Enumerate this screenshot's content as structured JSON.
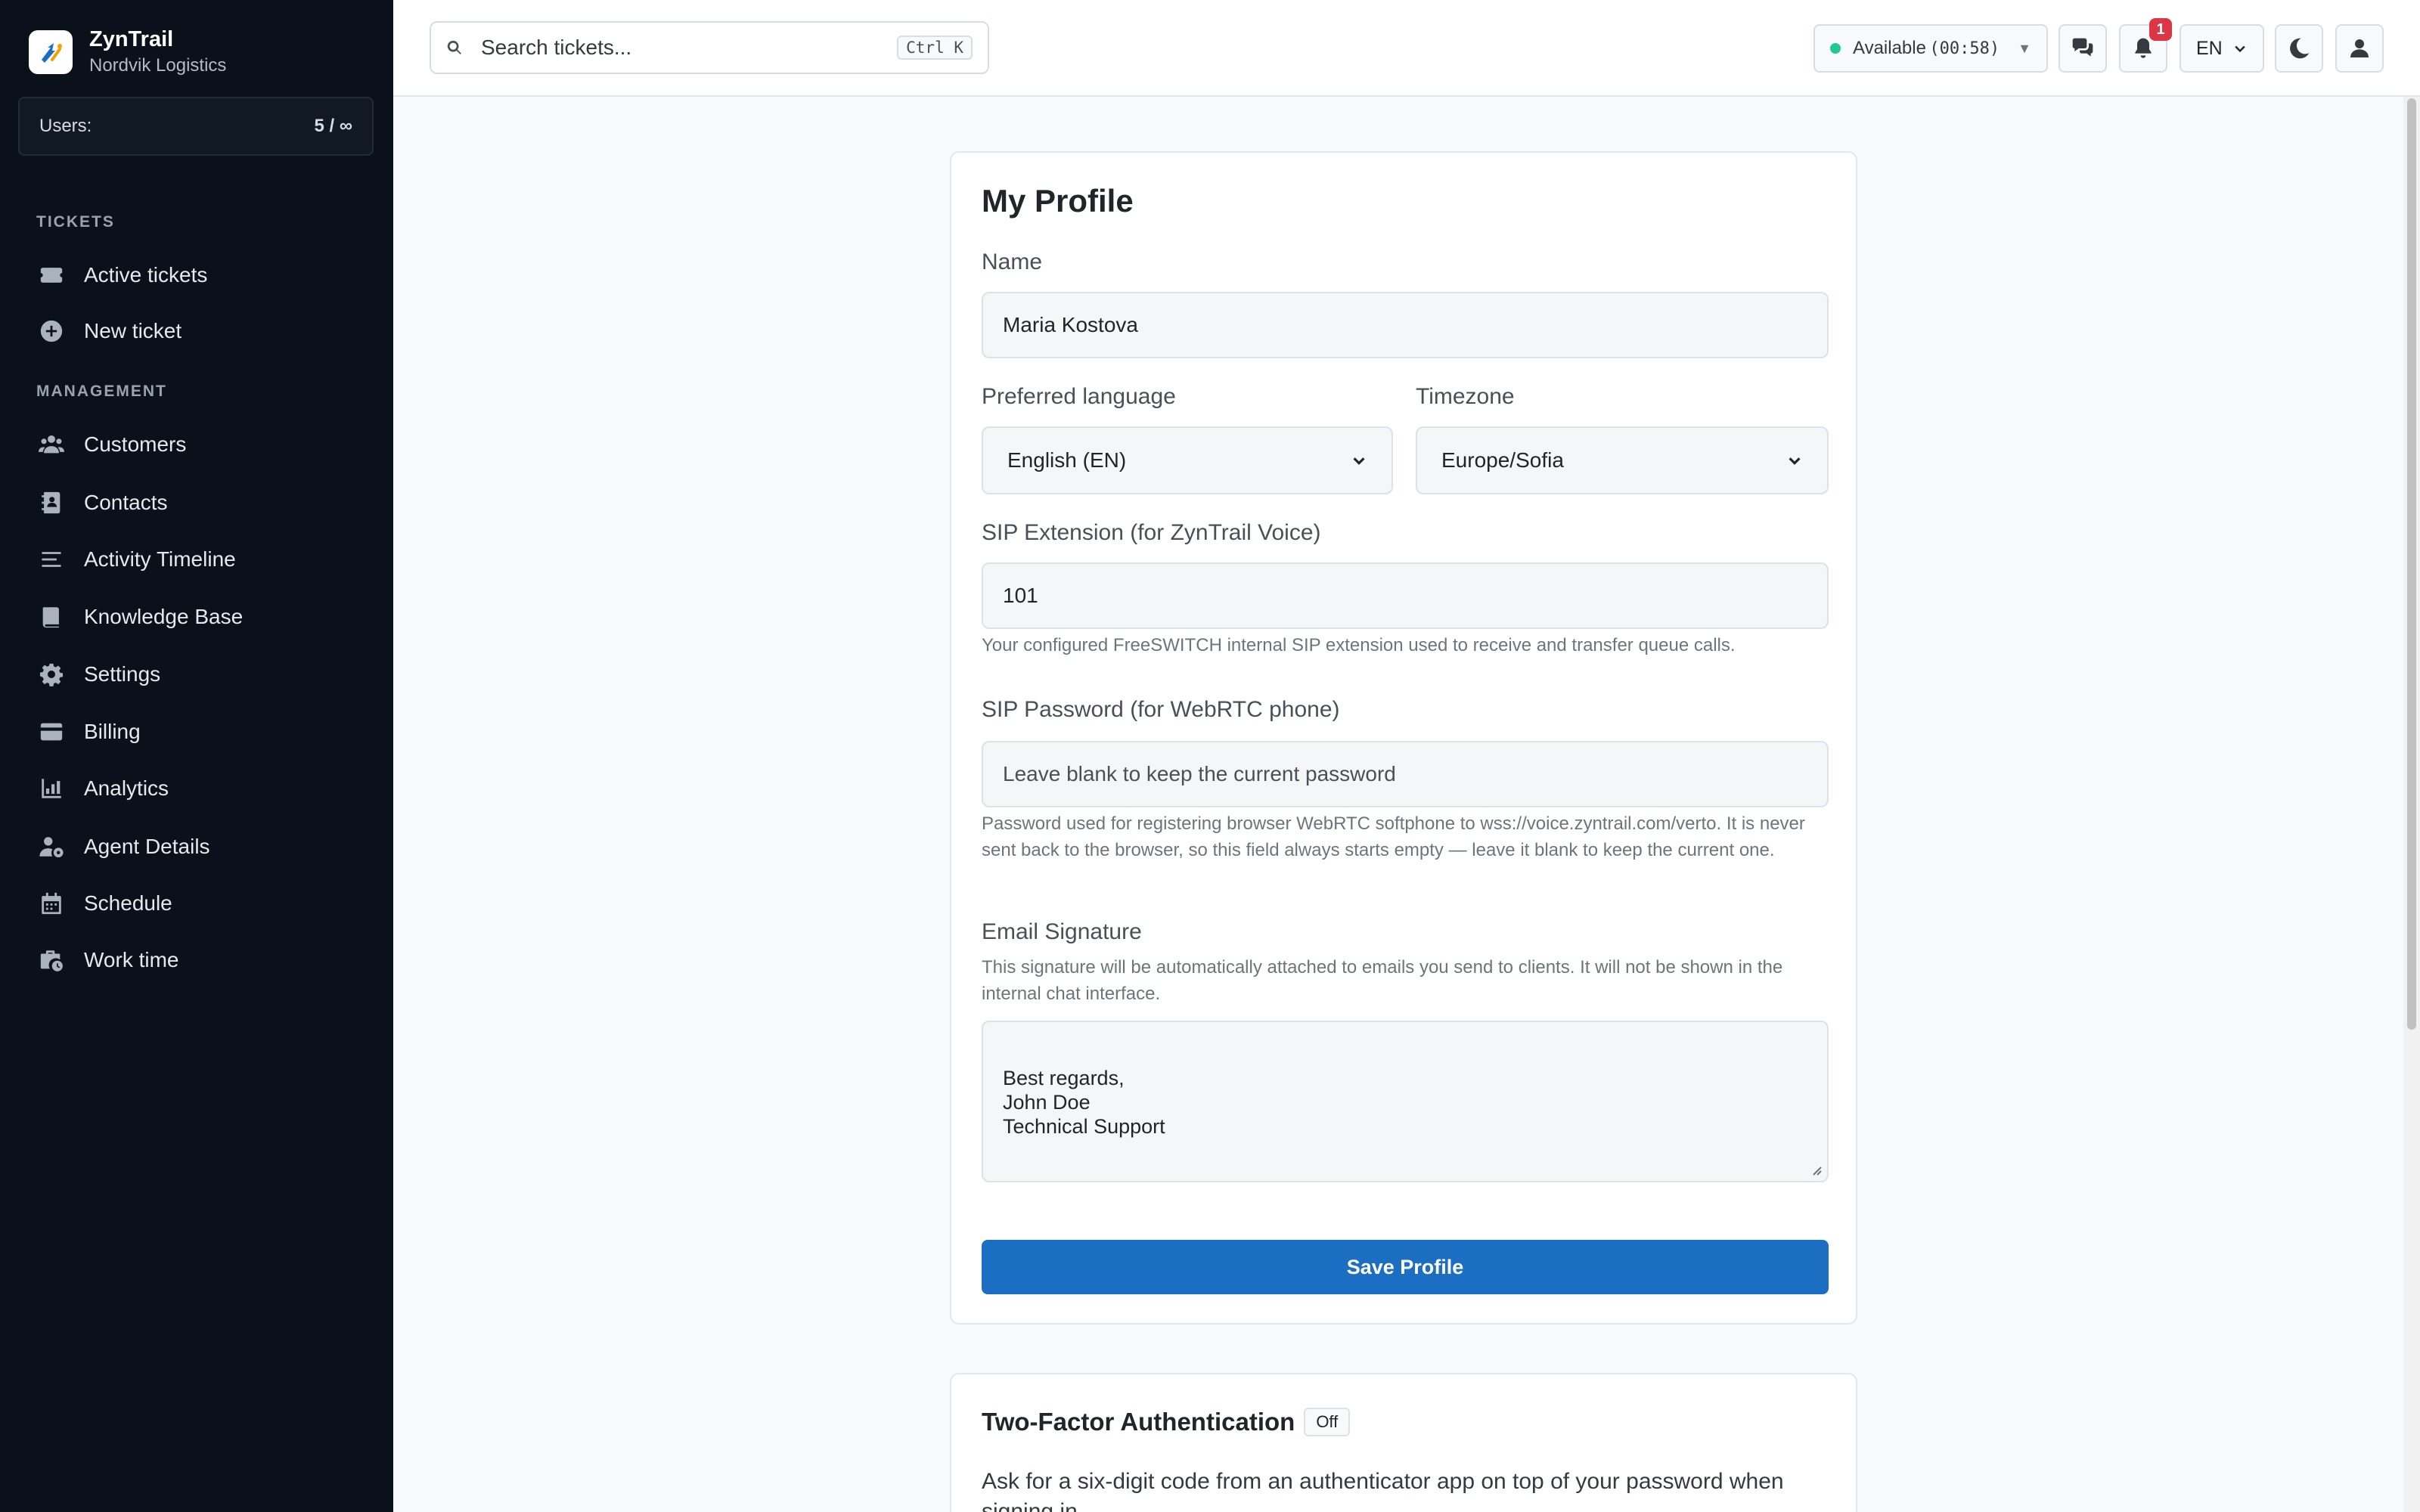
{
  "brand": {
    "name": "ZynTrail",
    "org": "Nordvik Logistics"
  },
  "users": {
    "label": "Users:",
    "value": "5 / ∞"
  },
  "nav": {
    "sections": {
      "tickets": "TICKETS",
      "management": "MANAGEMENT"
    },
    "items": [
      {
        "label": "Active tickets",
        "icon": "ticket-icon"
      },
      {
        "label": "New ticket",
        "icon": "plus-circle-icon"
      },
      {
        "label": "Customers",
        "icon": "users-icon"
      },
      {
        "label": "Contacts",
        "icon": "contact-book-icon"
      },
      {
        "label": "Activity Timeline",
        "icon": "list-icon"
      },
      {
        "label": "Knowledge Base",
        "icon": "book-icon"
      },
      {
        "label": "Settings",
        "icon": "gear-icon"
      },
      {
        "label": "Billing",
        "icon": "credit-card-icon"
      },
      {
        "label": "Analytics",
        "icon": "chart-icon"
      },
      {
        "label": "Agent Details",
        "icon": "user-gear-icon"
      },
      {
        "label": "Schedule",
        "icon": "calendar-icon"
      },
      {
        "label": "Work time",
        "icon": "briefcase-clock-icon"
      }
    ]
  },
  "topbar": {
    "search_placeholder": "Search tickets...",
    "search_shortcut": "Ctrl K",
    "status_label": "Available",
    "status_timer": "(00:58)",
    "status_color": "#20c997",
    "notifications_count": "1",
    "language": "EN"
  },
  "profile": {
    "title": "My Profile",
    "name_label": "Name",
    "name_value": "Maria Kostova",
    "language_label": "Preferred language",
    "language_value": "English (EN)",
    "timezone_label": "Timezone",
    "timezone_value": "Europe/Sofia",
    "sip_ext_label": "SIP Extension (for ZynTrail Voice)",
    "sip_ext_value": "101",
    "sip_ext_help": "Your configured FreeSWITCH internal SIP extension used to receive and transfer queue calls.",
    "sip_pw_label": "SIP Password (for WebRTC phone)",
    "sip_pw_placeholder": "Leave blank to keep the current password",
    "sip_pw_help": "Password used for registering browser WebRTC softphone to wss://voice.zyntrail.com/verto. It is never sent back to the browser, so this field always starts empty — leave it blank to keep the current one.",
    "signature_label": "Email Signature",
    "signature_help": "This signature will be automatically attached to emails you send to clients. It will not be shown in the internal chat interface.",
    "signature_value": "Best regards,\nJohn Doe\nTechnical Support",
    "save_label": "Save Profile",
    "accent_color": "#1b6ec2"
  },
  "tfa": {
    "title": "Two-Factor Authentication",
    "badge": "Off",
    "description": "Ask for a six-digit code from an authenticator app on top of your password when signing in."
  }
}
